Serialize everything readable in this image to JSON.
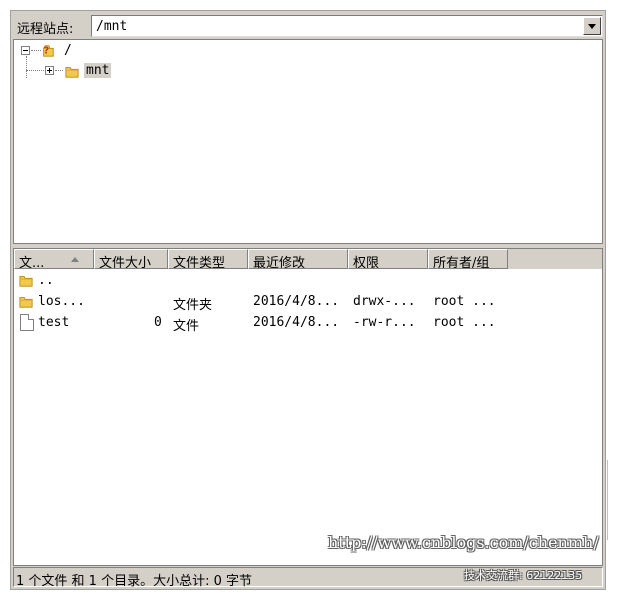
{
  "site_bar": {
    "label": "远程站点:",
    "path": "/mnt"
  },
  "tree": {
    "root_label": "/",
    "child_label": "mnt"
  },
  "columns": [
    {
      "label": "文..."
    },
    {
      "label": "文件大小"
    },
    {
      "label": "文件类型"
    },
    {
      "label": "最近修改"
    },
    {
      "label": "权限"
    },
    {
      "label": "所有者/组"
    }
  ],
  "rows": [
    {
      "name": "..",
      "size": "",
      "type": "",
      "modified": "",
      "perms": "",
      "owner": "",
      "icon": "folder-icon"
    },
    {
      "name": "los...",
      "size": "",
      "type": "文件夹",
      "modified": "2016/4/8...",
      "perms": "drwx-...",
      "owner": "root ...",
      "icon": "folder-icon"
    },
    {
      "name": "test",
      "size": "0",
      "type": "文件",
      "modified": "2016/4/8...",
      "perms": "-rw-r...",
      "owner": "root ...",
      "icon": "file-icon"
    }
  ],
  "status": {
    "text": "1 个文件 和 1 个目录。大小总计: 0 字节"
  },
  "watermark": {
    "url": "http://www.cnblogs.com/chenmh/",
    "group": "技术交流群: 62122135"
  },
  "colors": {
    "chrome": "#d4d0c8",
    "folder": "#f2c94c",
    "question_mark": "#c0392b"
  }
}
